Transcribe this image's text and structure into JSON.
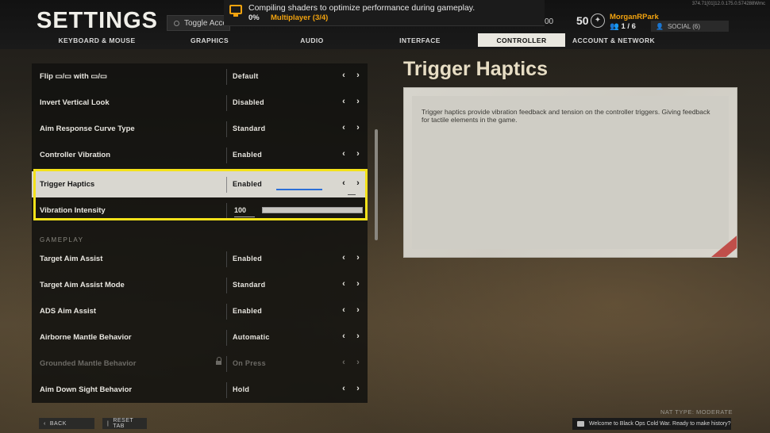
{
  "version": "374.71[01]12.0.175.0.574288Wmc",
  "header": {
    "title": "SETTINGS",
    "toggle_label": "Toggle Acce",
    "notification": {
      "message": "Compiling shaders to optimize performance during gameplay.",
      "percent": "0%",
      "mode": "Multiplayer (3/4)"
    },
    "partial_value": "00",
    "level": "50",
    "gamertag": "MorganRPark",
    "party": "1 / 6",
    "social": "SOCIAL (6)"
  },
  "tabs": [
    {
      "label": "KEYBOARD & MOUSE",
      "active": false
    },
    {
      "label": "GRAPHICS",
      "active": false
    },
    {
      "label": "AUDIO",
      "active": false
    },
    {
      "label": "INTERFACE",
      "active": false
    },
    {
      "label": "CONTROLLER",
      "active": true
    },
    {
      "label": "ACCOUNT & NETWORK",
      "active": false
    }
  ],
  "settings": {
    "flip": {
      "label": "Flip ▭/▭ with ▭/▭",
      "value": "Default"
    },
    "invert": {
      "label": "Invert Vertical Look",
      "value": "Disabled"
    },
    "aim_curve": {
      "label": "Aim Response Curve Type",
      "value": "Standard"
    },
    "vibration": {
      "label": "Controller Vibration",
      "value": "Enabled"
    },
    "trigger": {
      "label": "Trigger Haptics",
      "value": "Enabled"
    },
    "intensity": {
      "label": "Vibration Intensity",
      "value": "100"
    },
    "gameplay_header": "GAMEPLAY",
    "aim_assist": {
      "label": "Target Aim Assist",
      "value": "Enabled"
    },
    "aim_assist_mode": {
      "label": "Target Aim Assist Mode",
      "value": "Standard"
    },
    "ads_assist": {
      "label": "ADS Aim Assist",
      "value": "Enabled"
    },
    "airborne": {
      "label": "Airborne Mantle Behavior",
      "value": "Automatic"
    },
    "grounded": {
      "label": "Grounded Mantle Behavior",
      "value": "On Press"
    },
    "ads_behavior": {
      "label": "Aim Down Sight Behavior",
      "value": "Hold"
    }
  },
  "detail": {
    "title": "Trigger Haptics",
    "description": "Trigger haptics provide vibration feedback and tension on the controller triggers.  Giving feedback for tactile elements in the game."
  },
  "footer": {
    "back": "BACK",
    "reset": "RESET TAB",
    "nat": "NAT TYPE: MODERATE",
    "welcome": "Welcome to Black Ops Cold War. Ready to make history?"
  }
}
